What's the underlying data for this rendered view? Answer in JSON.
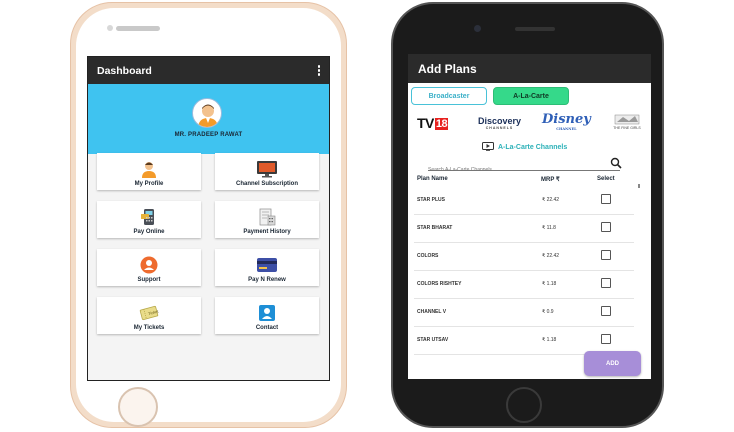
{
  "dashboard": {
    "title": "Dashboard",
    "user_name": "MR. PRADEEP  RAWAT",
    "tiles": [
      {
        "label": "My Profile",
        "icon": "user-icon"
      },
      {
        "label": "Channel Subscription",
        "icon": "tv-icon"
      },
      {
        "label": "Pay Online",
        "icon": "card-machine-icon"
      },
      {
        "label": "Payment History",
        "icon": "receipt-icon"
      },
      {
        "label": "Support",
        "icon": "support-icon"
      },
      {
        "label": "Pay N Renew",
        "icon": "credit-card-icon"
      },
      {
        "label": "My Tickets",
        "icon": "ticket-icon"
      },
      {
        "label": "Contact",
        "icon": "contact-icon"
      }
    ]
  },
  "add_plans": {
    "title": "Add Plans",
    "tabs": {
      "broadcaster": "Broadcaster",
      "alacarte": "A-La-Carte"
    },
    "brands": {
      "tv18": "TV",
      "tv18_num": "18",
      "discovery": "Discovery",
      "discovery_sub": "CHANNELS",
      "disney": "Disney",
      "disney_sub": "CHANNEL",
      "finegirl": "THE FINE GIRLS"
    },
    "section_title": "A-La-Carte Channels",
    "search_placeholder": "Search A-La-Carte Channels",
    "columns": {
      "name": "Plan Name",
      "mrp": "MRP ₹",
      "select": "Select"
    },
    "rows": [
      {
        "name": "STAR PLUS",
        "mrp": "₹ 22.42"
      },
      {
        "name": "STAR BHARAT",
        "mrp": "₹ 11.8"
      },
      {
        "name": "COLORS",
        "mrp": "₹ 22.42"
      },
      {
        "name": "COLORS RISHTEY",
        "mrp": "₹ 1.18"
      },
      {
        "name": "CHANNEL V",
        "mrp": "₹ 0.9"
      },
      {
        "name": "STAR UTSAV",
        "mrp": "₹ 1.18"
      }
    ],
    "add_label": "ADD"
  },
  "colors": {
    "header": "#2b2b2b",
    "profile_band": "#3fc3f0",
    "tab_active": "#35d98a",
    "add_button": "#a78ed8"
  }
}
